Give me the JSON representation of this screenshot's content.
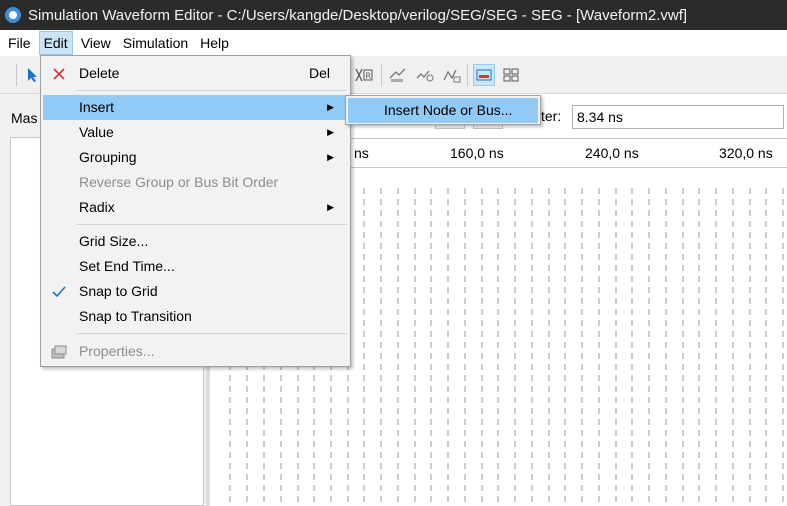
{
  "window": {
    "title": "Simulation Waveform Editor - C:/Users/kangde/Desktop/verilog/SEG/SEG - SEG - [Waveform2.vwf]"
  },
  "menubar": {
    "items": [
      "File",
      "Edit",
      "View",
      "Simulation",
      "Help"
    ],
    "active": "Edit"
  },
  "left_panel": {
    "label": "Mas"
  },
  "interval": {
    "label": "ter:",
    "value": "8.34 ns"
  },
  "ruler": {
    "ticks": [
      "ns",
      "160,0 ns",
      "240,0 ns",
      "320,0 ns"
    ]
  },
  "edit_menu": {
    "delete": {
      "label": "Delete",
      "shortcut": "Del",
      "icon": "delete-x-icon"
    },
    "insert": {
      "label": "Insert"
    },
    "value": {
      "label": "Value"
    },
    "grouping": {
      "label": "Grouping"
    },
    "reverse_group": {
      "label": "Reverse Group or Bus Bit Order"
    },
    "radix": {
      "label": "Radix"
    },
    "grid_size": {
      "label": "Grid Size..."
    },
    "set_end_time": {
      "label": "Set End Time..."
    },
    "snap_to_grid": {
      "label": "Snap to Grid",
      "checked": true
    },
    "snap_to_transition": {
      "label": "Snap to Transition"
    },
    "properties": {
      "label": "Properties...",
      "icon": "properties-icon"
    }
  },
  "insert_submenu": {
    "insert_node": "Insert Node or Bus..."
  },
  "colors": {
    "highlight": "#91c9f7",
    "menu_bg": "#f2f2f2",
    "titlebar": "#2b2b2b",
    "accent": "#3b8fd9"
  }
}
